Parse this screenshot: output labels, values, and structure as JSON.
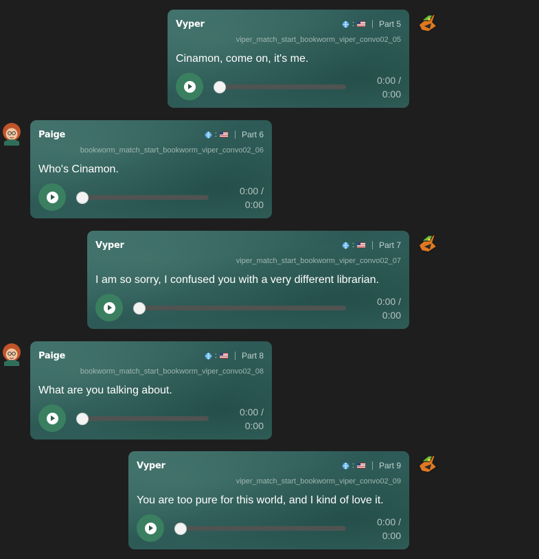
{
  "messages": [
    {
      "speaker": "Vyper",
      "side": "right",
      "file_id": "viper_match_start_bookworm_viper_convo02_05",
      "part": "Part 5",
      "text": "Cinamon, come on, it's me.",
      "time_current": "0:00 /",
      "time_total": "0:00",
      "progress": 0
    },
    {
      "speaker": "Paige",
      "side": "left",
      "file_id": "bookworm_match_start_bookworm_viper_convo02_06",
      "part": "Part 6",
      "text": "Who's Cinamon.",
      "time_current": "0:00 /",
      "time_total": "0:00",
      "progress": 0
    },
    {
      "speaker": "Vyper",
      "side": "right",
      "file_id": "viper_match_start_bookworm_viper_convo02_07",
      "part": "Part 7",
      "text": "I am so sorry, I confused you with a very different librarian.",
      "time_current": "0:00 /",
      "time_total": "0:00",
      "progress": 0
    },
    {
      "speaker": "Paige",
      "side": "left",
      "file_id": "bookworm_match_start_bookworm_viper_convo02_08",
      "part": "Part 8",
      "text": "What are you talking about.",
      "time_current": "0:00 /",
      "time_total": "0:00",
      "progress": 0
    },
    {
      "speaker": "Vyper",
      "side": "right",
      "file_id": "viper_match_start_bookworm_viper_convo02_09",
      "part": "Part 9",
      "text": "You are too pure for this world, and I kind of love it.",
      "time_current": "0:00 /",
      "time_total": "0:00",
      "progress": 0
    }
  ],
  "icons": {
    "vyper_avatar": "snake-creature-avatar-icon",
    "paige_avatar": "red-haired-girl-avatar-icon",
    "globe": "globe-icon",
    "flag": "us-flag-icon",
    "play": "play-icon"
  },
  "colors": {
    "bubble": "#2f5b57",
    "play_button": "#3a8060",
    "background": "#1e1e1e"
  }
}
